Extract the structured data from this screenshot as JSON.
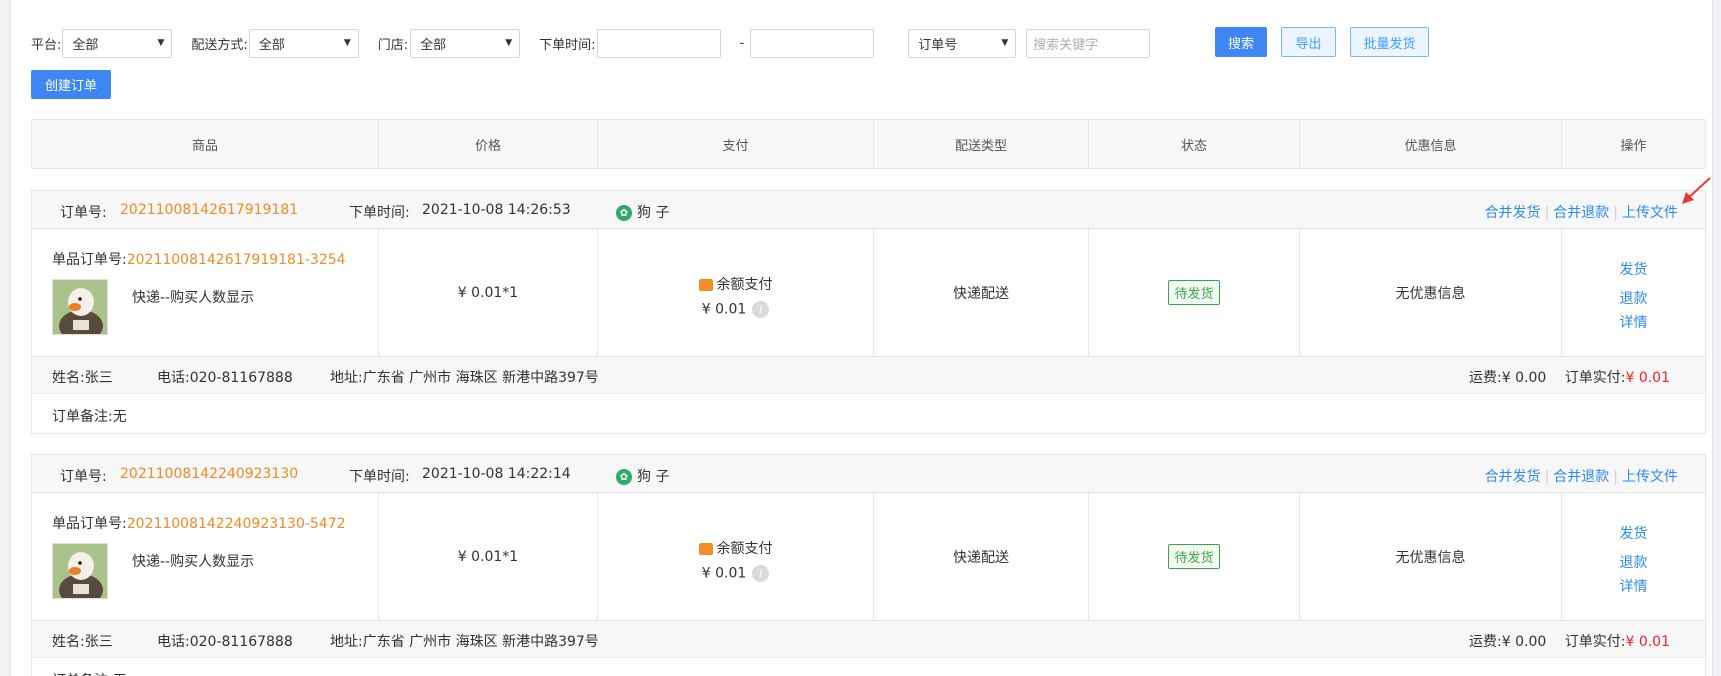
{
  "filters": {
    "platform_label": "平台:",
    "platform_value": "全部",
    "delivery_label": "配送方式:",
    "delivery_value": "全部",
    "store_label": "门店:",
    "store_value": "全部",
    "time_label": "下单时间:",
    "time_start": "",
    "time_sep": "-",
    "time_end": "",
    "search_type_value": "订单号",
    "search_placeholder": "搜索关键字",
    "search_btn": "搜索",
    "export_btn": "导出",
    "batch_ship_btn": "批量发货",
    "create_order_btn": "创建订单"
  },
  "table": {
    "headers": [
      "商品",
      "价格",
      "支付",
      "配送类型",
      "状态",
      "优惠信息",
      "操作"
    ]
  },
  "labels": {
    "order_no": "订单号:",
    "order_time": "下单时间:",
    "item_order_no": "单品订单号:",
    "merge_ship": "合并发货",
    "merge_refund": "合并退款",
    "upload_file": "上传文件",
    "name": "姓名:",
    "phone": "电话:",
    "address": "地址:",
    "freight": "运费:",
    "paid": "订单实付:",
    "remark": "订单备注:",
    "ship": "发货",
    "refund": "退款",
    "detail": "详情"
  },
  "orders": [
    {
      "order_no": "20211008142617919181",
      "order_time": "2021-10-08 14:26:53",
      "buyer": "狗 子",
      "item_order_no": "20211008142617919181-3254",
      "product_name": "快递--购买人数显示",
      "price": "¥ 0.01*1",
      "pay_method": "余额支付",
      "pay_amount": "¥ 0.01",
      "delivery_type": "快递配送",
      "status": "待发货",
      "discount": "无优惠信息",
      "name": "张三",
      "phone": "020-81167888",
      "address": "广东省 广州市 海珠区 新港中路397号",
      "freight": "¥ 0.00",
      "paid": "¥ 0.01",
      "remark": "无"
    },
    {
      "order_no": "20211008142240923130",
      "order_time": "2021-10-08 14:22:14",
      "buyer": "狗 子",
      "item_order_no": "20211008142240923130-5472",
      "product_name": "快递--购买人数显示",
      "price": "¥ 0.01*1",
      "pay_method": "余额支付",
      "pay_amount": "¥ 0.01",
      "delivery_type": "快递配送",
      "status": "待发货",
      "discount": "无优惠信息",
      "name": "张三",
      "phone": "020-81167888",
      "address": "广东省 广州市 海珠区 新港中路397号",
      "freight": "¥ 0.00",
      "paid": "¥ 0.01",
      "remark": "无"
    }
  ],
  "colors": {
    "primary": "#3f86f5",
    "link": "#2d8cf0",
    "order_no": "#f08a24",
    "status": "#3aa649",
    "paid": "#f5222d",
    "annotation_arrow": "#e8382f"
  }
}
